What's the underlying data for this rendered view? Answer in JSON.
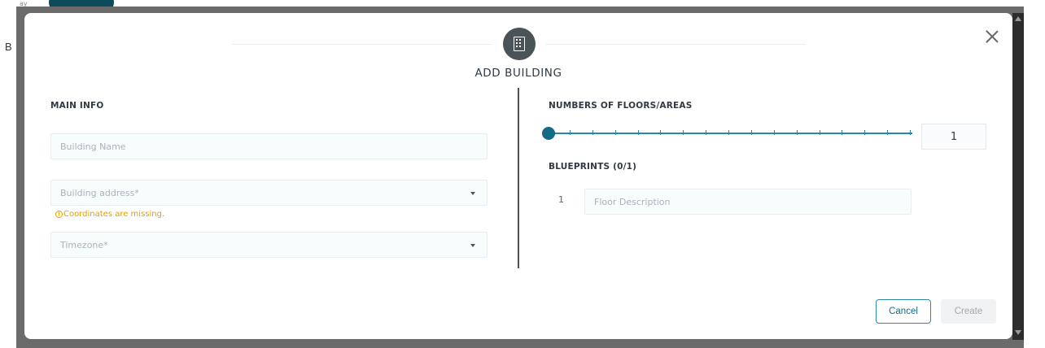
{
  "background": {
    "partial_text": "ay",
    "side_letter": "B"
  },
  "modal": {
    "title": "ADD BUILDING",
    "icon": "building-icon",
    "close_icon": "close-icon"
  },
  "main_info": {
    "label": "MAIN INFO",
    "building_name": {
      "placeholder": "Building Name",
      "value": ""
    },
    "building_address": {
      "placeholder": "Building address*",
      "value": ""
    },
    "address_warning": "Coordinates are missing.",
    "timezone": {
      "placeholder": "Timezone*",
      "value": ""
    }
  },
  "floors": {
    "label": "NUMBERS OF FLOORS/AREAS",
    "value": "1",
    "slider_level": 1
  },
  "blueprints": {
    "label": "BLUEPRINTS (0/1)",
    "rows": [
      {
        "index": "1",
        "placeholder": "Floor Description"
      }
    ]
  },
  "footer": {
    "cancel_label": "Cancel",
    "create_label": "Create"
  },
  "colors": {
    "accent": "#136b86",
    "warning": "#e0a100",
    "icon_bg": "#4a5358"
  }
}
